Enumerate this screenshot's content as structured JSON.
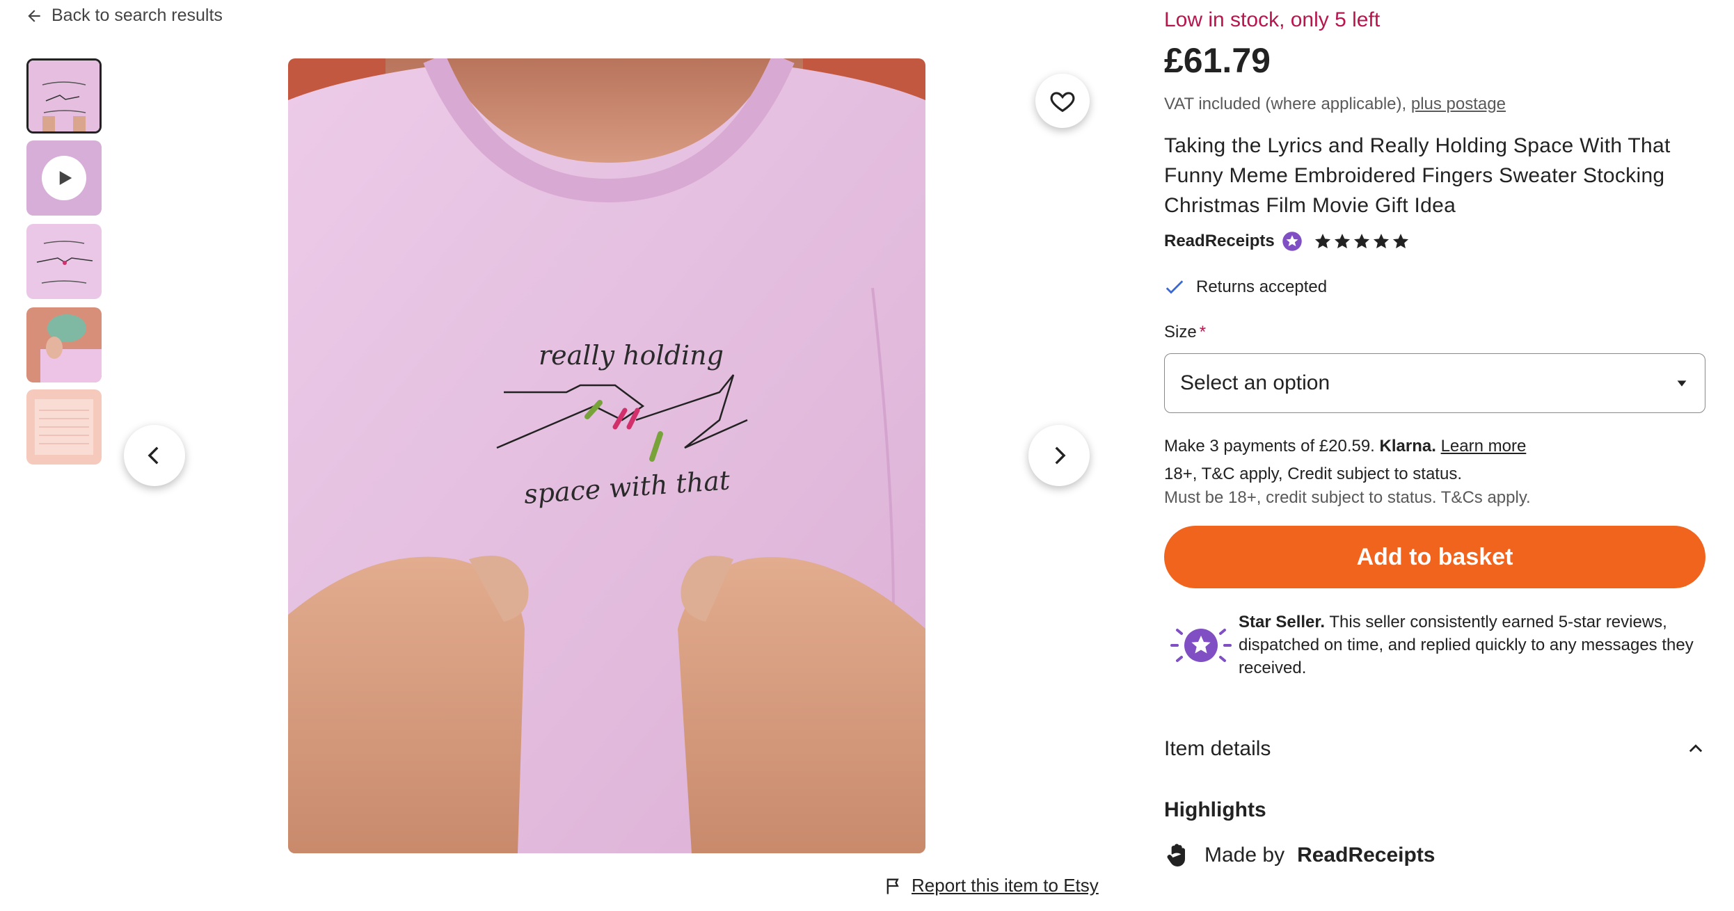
{
  "nav": {
    "back_label": "Back to search results"
  },
  "gallery": {
    "thumbnails": [
      {
        "kind": "image",
        "selected": true
      },
      {
        "kind": "video",
        "selected": false
      },
      {
        "kind": "image",
        "selected": false
      },
      {
        "kind": "image",
        "selected": false
      },
      {
        "kind": "image",
        "selected": false
      }
    ],
    "main_image_text_top": "really holding",
    "main_image_text_bottom": "space with that",
    "report_label": "Report this item to Etsy"
  },
  "listing": {
    "stock_notice": "Low in stock, only 5 left",
    "price": "£61.79",
    "vat_text": "VAT included (where applicable),",
    "postage_link": "plus postage",
    "title": "Taking the Lyrics and Really Holding Space With That Funny Meme Embroidered Fingers Sweater Stocking Christmas Film Movie Gift Idea",
    "shop_name": "ReadReceipts",
    "rating_stars": 5,
    "returns": "Returns accepted",
    "size_label": "Size",
    "size_required": "*",
    "size_placeholder": "Select an option",
    "klarna_text": "Make 3 payments of £20.59.",
    "klarna_brand": "Klarna.",
    "klarna_link": "Learn more",
    "klarna_terms": "18+, T&C apply, Credit subject to status.",
    "klarna_note": "Must be 18+, credit subject to status. T&Cs apply.",
    "add_to_basket": "Add to basket",
    "star_seller_title": "Star Seller.",
    "star_seller_desc": "This seller consistently earned 5-star reviews, dispatched on time, and replied quickly to any messages they received.",
    "item_details": "Item details",
    "highlights": "Highlights",
    "made_by_prefix": "Made by",
    "made_by_shop": "ReadReceipts"
  },
  "colors": {
    "stock_red": "#b8154e",
    "basket_orange": "#f1641e",
    "star_purple": "#7f4fc3",
    "shirt_pink": "#e8bfe0"
  }
}
